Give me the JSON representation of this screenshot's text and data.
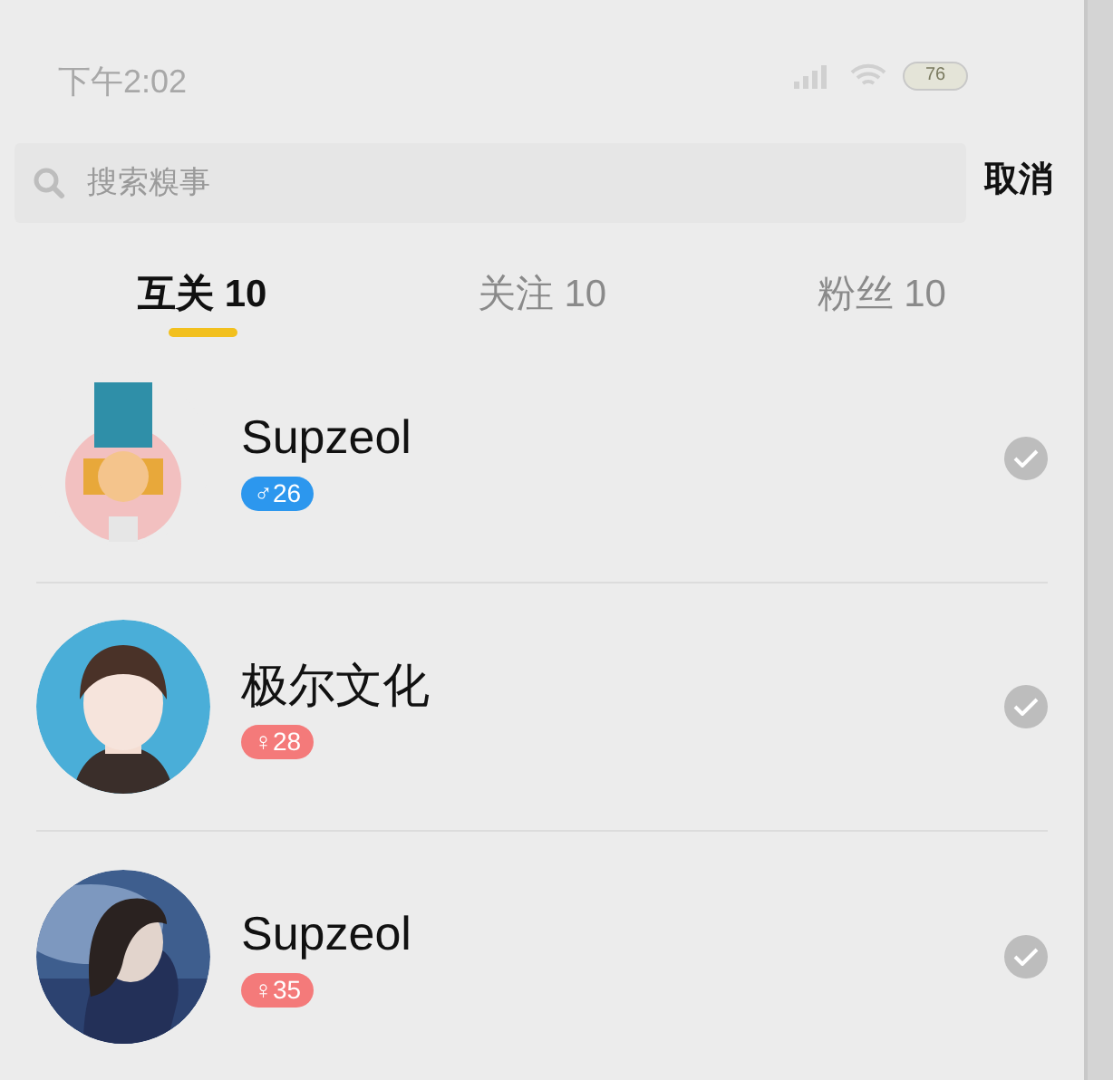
{
  "status_bar": {
    "time": "下午2:02",
    "battery": "76"
  },
  "search": {
    "placeholder": "搜索糗事"
  },
  "cancel_button": "取消",
  "tabs": [
    {
      "label": "互关 10",
      "selected": true
    },
    {
      "label": "关注 10",
      "selected": false
    },
    {
      "label": "粉丝 10",
      "selected": false
    }
  ],
  "users": [
    {
      "name": "Supzeol",
      "badge": "♂26",
      "color": "#2c97ee",
      "kind": "picture"
    },
    {
      "name": "极尔文化",
      "badge": "♀28",
      "color": "#f47a7a",
      "kind": "picture"
    },
    {
      "name": "Supzeol",
      "badge": "♀35",
      "color": "#f47a7a",
      "kind": "picture"
    }
  ]
}
